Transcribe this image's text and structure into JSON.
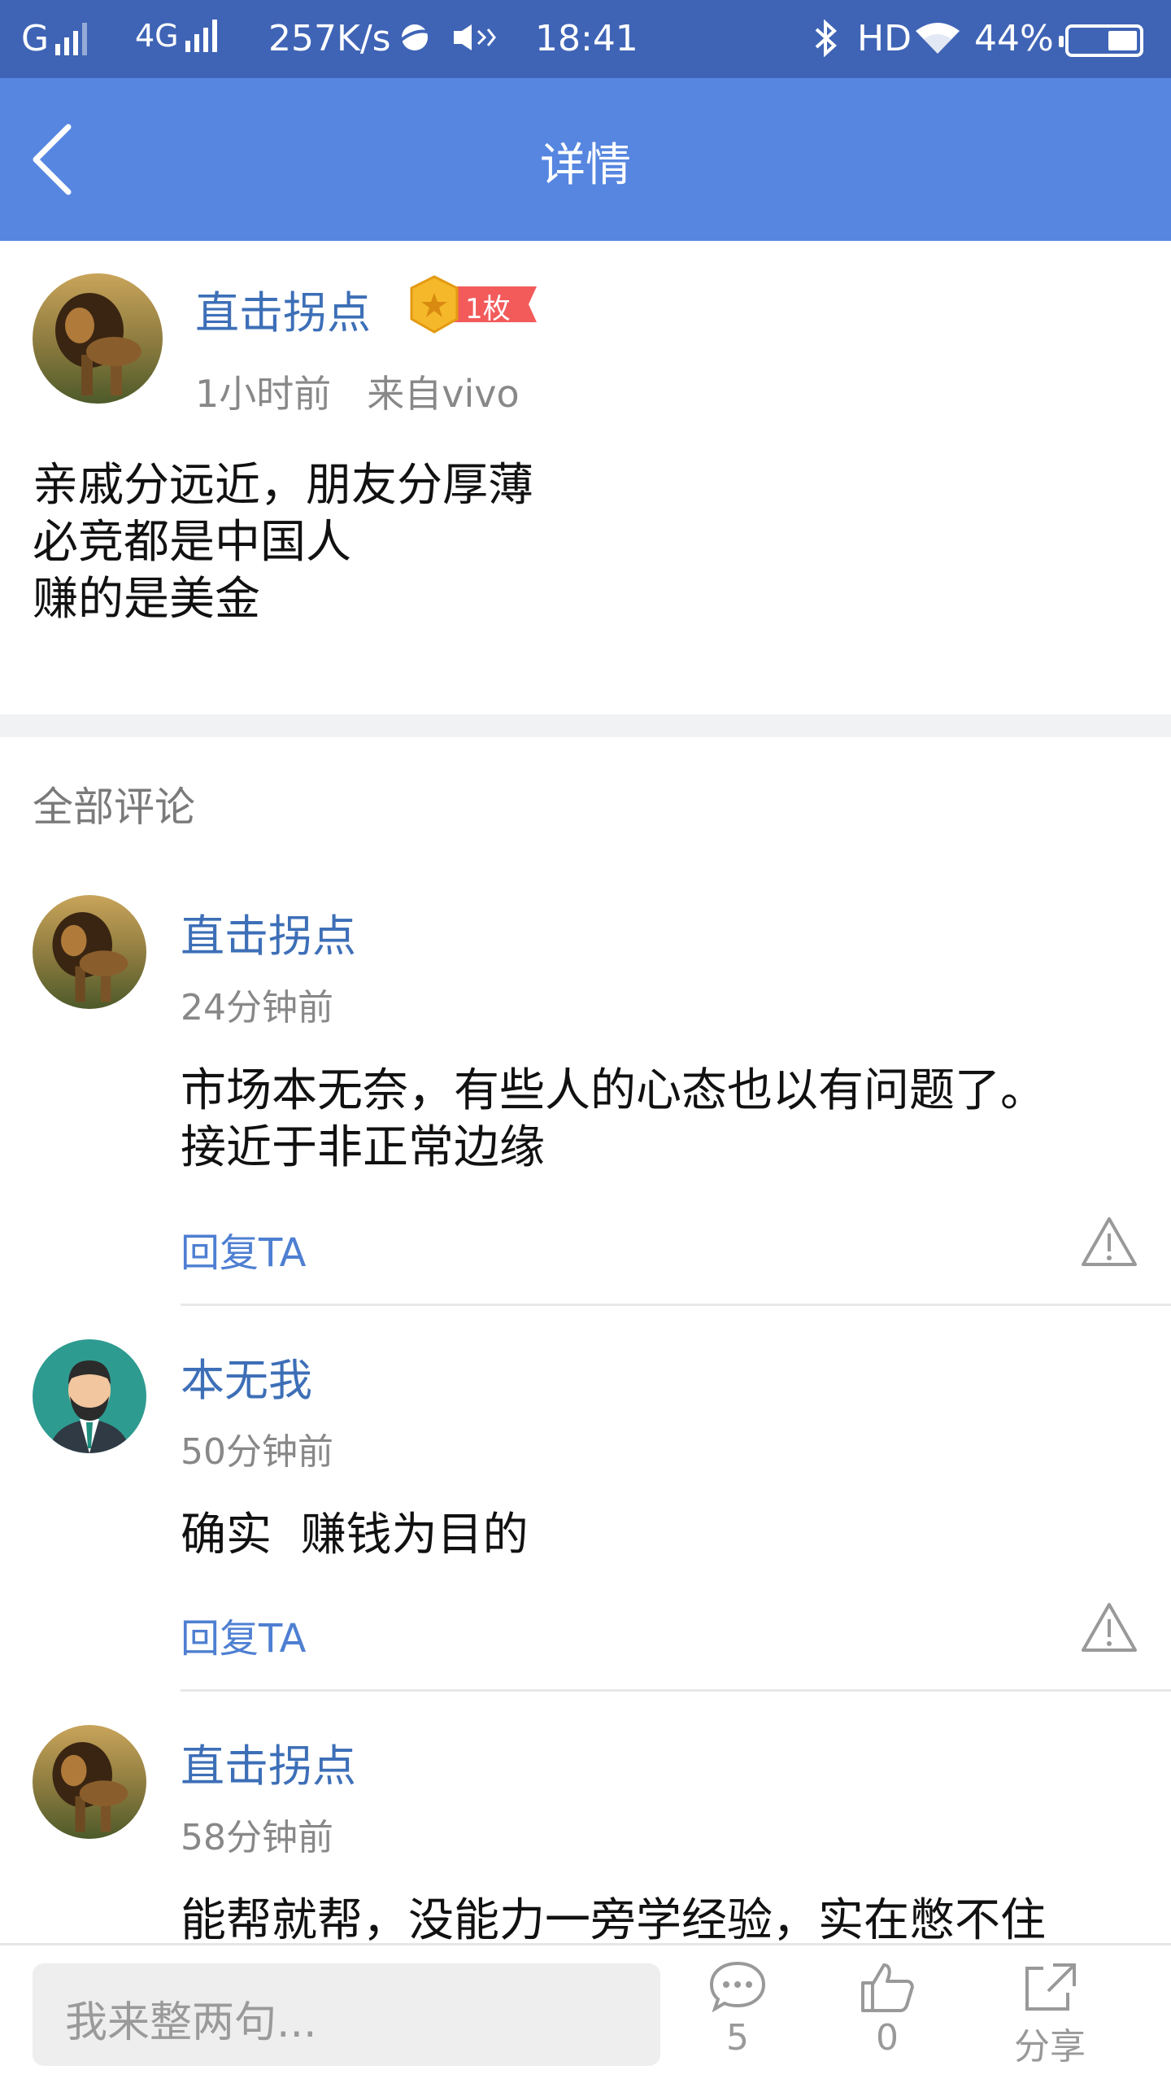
{
  "status_bar": {
    "carrier1": "G",
    "carrier2": "4G",
    "speed": "257K/s",
    "time": "18:41",
    "hd": "HD",
    "battery": "44%",
    "battery_level": 0.44
  },
  "header": {
    "title": "详情"
  },
  "post": {
    "author": "直击拐点",
    "badge_count": "1枚",
    "time": "1小时前",
    "source": "来自vivo",
    "lines": [
      "亲戚分远近，朋友分厚薄",
      "必竞都是中国人",
      "赚的是美金"
    ]
  },
  "comments_section": {
    "title": "全部评论"
  },
  "comments": [
    {
      "author": "直击拐点",
      "time": "24分钟前",
      "lines": [
        "市场本无奈，有些人的心态也以有问题了。",
        "接近于非正常边缘"
      ],
      "reply": "回复TA"
    },
    {
      "author": "本无我",
      "time": "50分钟前",
      "lines": [
        "确实  赚钱为目的"
      ],
      "reply": "回复TA"
    },
    {
      "author": "直击拐点",
      "time": "58分钟前",
      "lines": [
        "能帮就帮，没能力一旁学经验，实在憋不住"
      ]
    }
  ],
  "bottom_bar": {
    "input_placeholder": "我来整两句...",
    "comment_count": "5",
    "like_count": "0",
    "share_label": "分享"
  }
}
